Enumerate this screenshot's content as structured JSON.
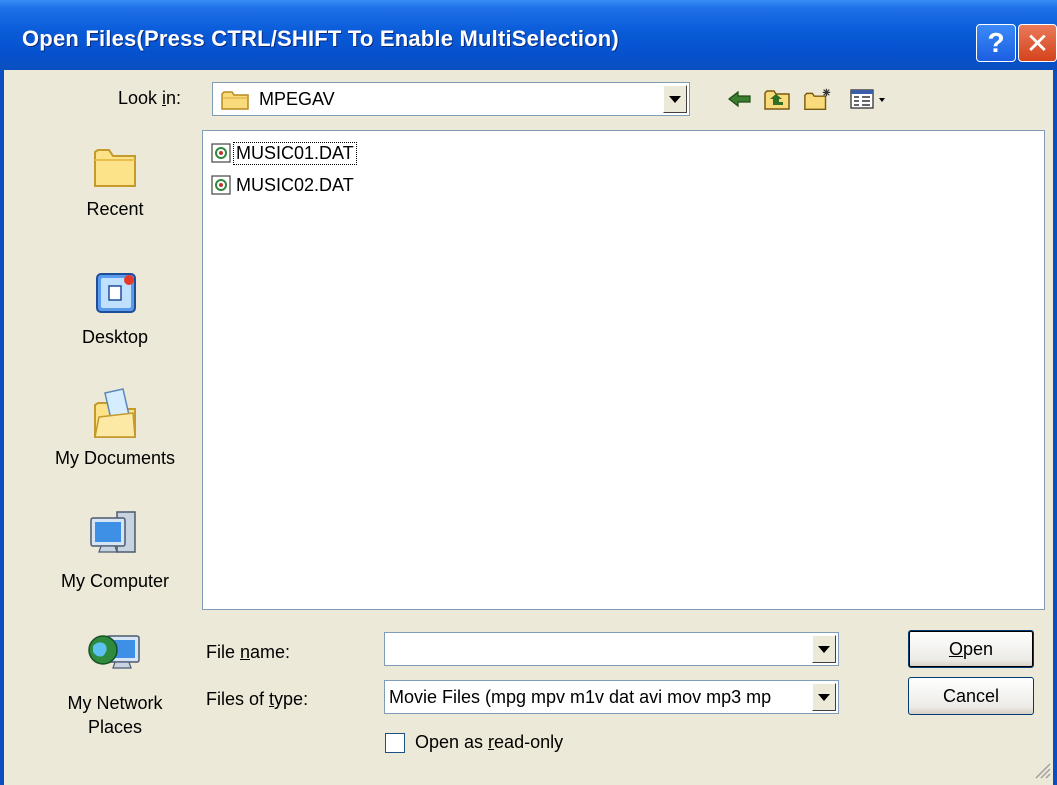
{
  "window": {
    "title": "Open Files(Press CTRL/SHIFT To Enable MultiSelection)",
    "help_glyph": "?",
    "close_glyph": "✕"
  },
  "look_in": {
    "label_pre": "Look ",
    "label_accel": "i",
    "label_post": "n:",
    "value": "MPEGAV"
  },
  "toolbar": {
    "icons": [
      "back-arrow-icon",
      "up-one-level-icon",
      "create-new-folder-icon",
      "view-menu-icon"
    ]
  },
  "places": [
    {
      "label": "Recent",
      "icon": "recent-folder-icon"
    },
    {
      "label": "Desktop",
      "icon": "desktop-icon"
    },
    {
      "label": "My Documents",
      "icon": "my-documents-icon"
    },
    {
      "label": "My Computer",
      "icon": "my-computer-icon"
    },
    {
      "label_line1": "My Network",
      "label_line2": "Places",
      "icon": "my-network-places-icon"
    }
  ],
  "files": [
    {
      "name": "MUSIC01.DAT",
      "focused": true
    },
    {
      "name": "MUSIC02.DAT",
      "focused": false
    }
  ],
  "file_name": {
    "label_pre": "File ",
    "label_accel": "n",
    "label_post": "ame:",
    "value": ""
  },
  "file_type": {
    "label_pre": "Files of ",
    "label_accel": "t",
    "label_post": "ype:",
    "value": "Movie Files (mpg mpv m1v dat avi mov mp3 mp"
  },
  "buttons": {
    "open_accel": "O",
    "open_rest": "pen",
    "cancel": "Cancel"
  },
  "readonly": {
    "label_pre": "Open as ",
    "label_accel": "r",
    "label_post": "ead-only",
    "checked": false
  },
  "colors": {
    "titlebar": "#0A5BD8",
    "dialog_bg": "#ECE9D8",
    "field_border": "#7F9DB9"
  }
}
